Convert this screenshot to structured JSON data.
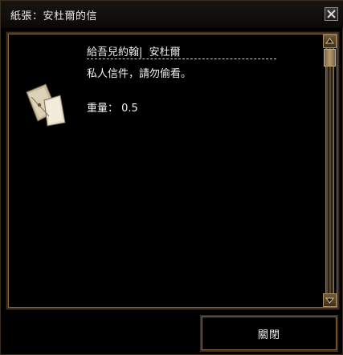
{
  "window": {
    "title": "紙張：安杜爾的信",
    "close_icon": "close-x-icon"
  },
  "item": {
    "icon": "folded-letter-icon",
    "to_line": "給吾兒約翰|  安杜爾",
    "description": "私人信件，請勿偷看。",
    "weight_label": "重量：",
    "weight_value": "0.5"
  },
  "scrollbar": {
    "up_icon": "scroll-up-arrow-icon",
    "down_icon": "scroll-down-arrow-icon"
  },
  "footer": {
    "close_label": "關閉"
  },
  "colors": {
    "background": "#000000",
    "frame_gold": "#8a6a3d",
    "text": "#f0f0f0"
  }
}
